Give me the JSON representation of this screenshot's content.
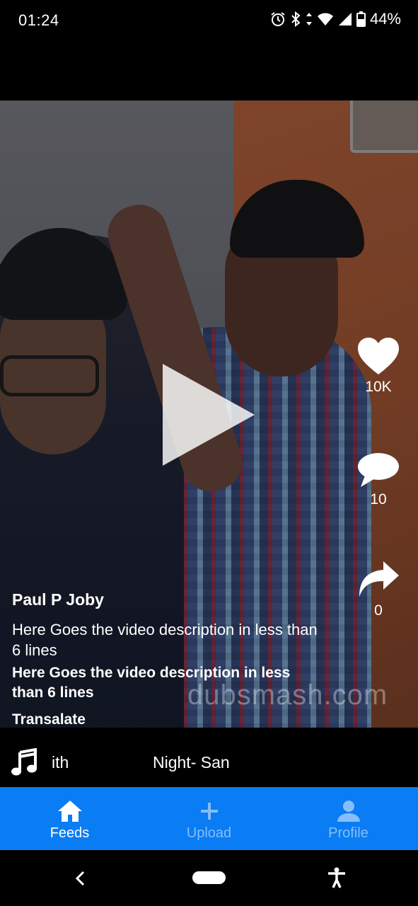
{
  "status_bar": {
    "time": "01:24",
    "battery": "44%",
    "icons": [
      "alarm-icon",
      "bluetooth-icon",
      "data-arrows-icon",
      "wifi-icon",
      "cell-signal-icon",
      "battery-icon"
    ]
  },
  "video": {
    "watermark": "dubsmash.com",
    "play_icon": "play-icon"
  },
  "actions": {
    "like": {
      "icon": "heart-icon",
      "count": "10K"
    },
    "comment": {
      "icon": "comment-icon",
      "count": "10"
    },
    "share": {
      "icon": "share-icon",
      "count": "0"
    }
  },
  "caption": {
    "author": "Paul P Joby",
    "description": "Here Goes the video description in less than 6 lines",
    "description_bold": "Here Goes the video description in less than 6 lines",
    "translate_label": "Transalate"
  },
  "music": {
    "icon": "music-note-icon",
    "artist": "ith",
    "track": "Night- San"
  },
  "bottom_nav": {
    "items": [
      {
        "label": "Feeds",
        "icon": "home-icon",
        "active": true
      },
      {
        "label": "Upload",
        "icon": "plus-icon",
        "active": false
      },
      {
        "label": "Profile",
        "icon": "person-icon",
        "active": false
      }
    ],
    "active_color": "#ffffff",
    "background": "#0a7cf4"
  },
  "system_nav": {
    "icons": [
      "back-icon",
      "home-pill",
      "accessibility-icon"
    ]
  }
}
